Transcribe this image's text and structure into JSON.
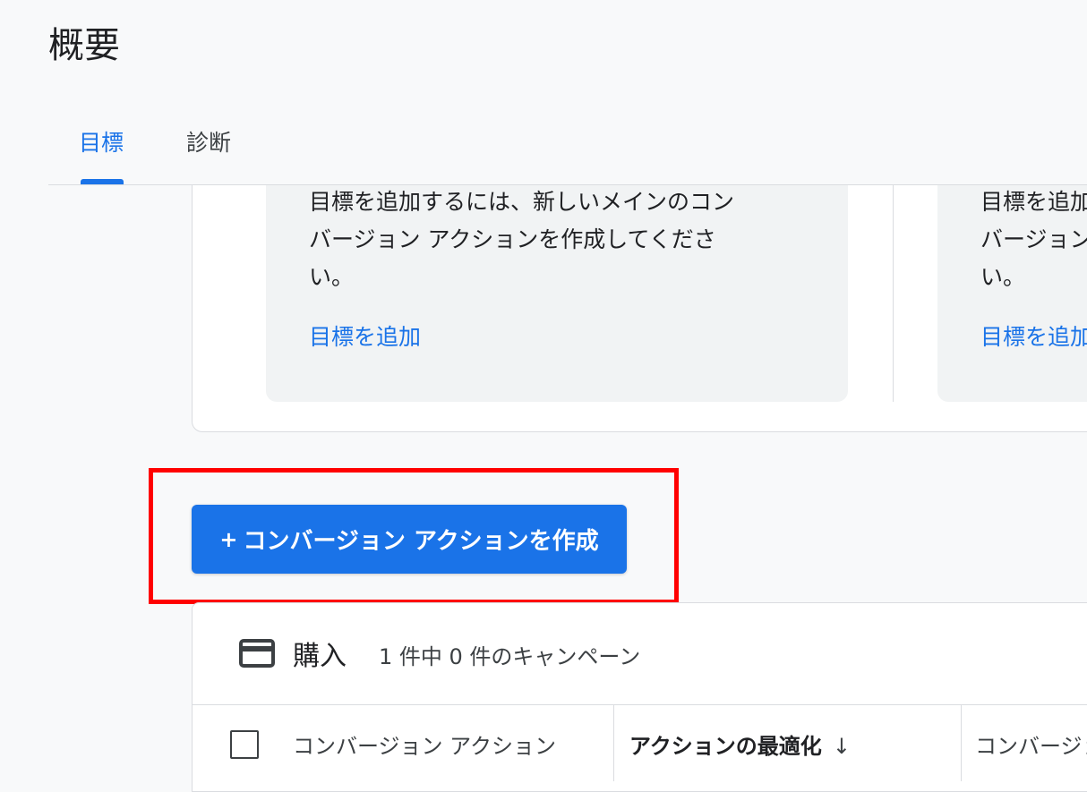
{
  "page": {
    "title": "概要"
  },
  "tabs": [
    {
      "label": "目標",
      "active": true
    },
    {
      "label": "診断",
      "active": false
    }
  ],
  "goal_cards": [
    {
      "description": "目標を追加するには、新しいメインのコン\nバージョン アクションを作成してくださ\nい。",
      "link": "目標を追加"
    },
    {
      "description": "目標を追加\nバージョン\nい。",
      "link": "目標を追加"
    }
  ],
  "create_button": {
    "plus": "+",
    "label": "コンバージョン アクションを作成"
  },
  "category": {
    "icon": "credit-card-icon",
    "name": "購入",
    "count_text": "1 件中 0 件のキャンペーン"
  },
  "table": {
    "columns": [
      "コンバージョン アクション",
      "アクションの最適化",
      "コンバージョン"
    ],
    "sort_icon": "↓"
  },
  "colors": {
    "accent": "#1a73e8",
    "highlight": "#ff0000"
  }
}
